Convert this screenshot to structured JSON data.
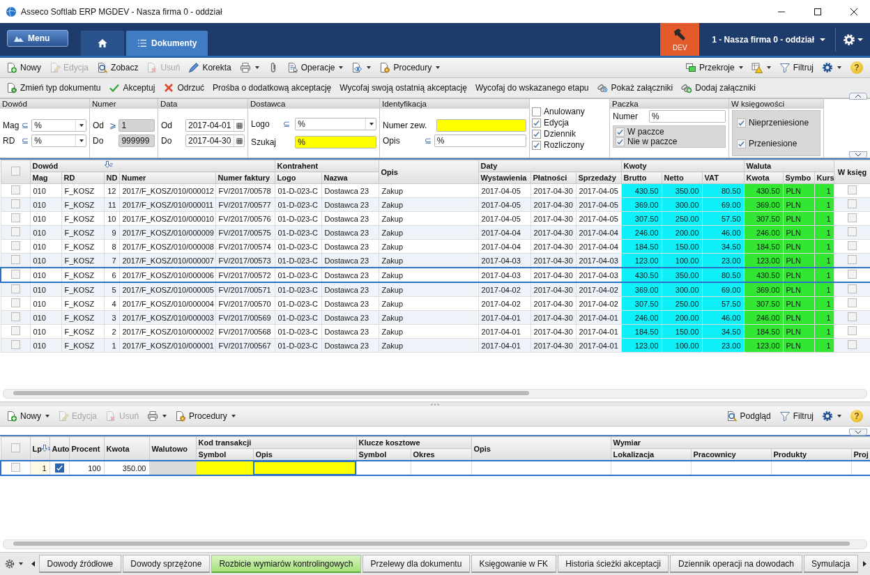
{
  "window": {
    "title": "Asseco Softlab ERP MGDEV - Nasza firma 0 - oddział"
  },
  "nav": {
    "menu": "Menu",
    "tabs": [
      {
        "kind": "home",
        "selected": false
      },
      {
        "kind": "documents",
        "label": "Dokumenty",
        "selected": true
      }
    ],
    "environment": "DEV",
    "company": "1 - Nasza firma 0 - oddział"
  },
  "toolbar": {
    "left": [
      {
        "kind": "new",
        "label": "Nowy",
        "disabled": false,
        "dropdown": false
      },
      {
        "kind": "edit",
        "label": "Edycja",
        "disabled": true,
        "dropdown": false
      },
      {
        "kind": "view",
        "label": "Zobacz",
        "disabled": false,
        "dropdown": false
      },
      {
        "kind": "delete",
        "label": "Usuń",
        "disabled": true,
        "dropdown": false
      },
      {
        "kind": "correct",
        "label": "Korekta",
        "disabled": false,
        "dropdown": false
      },
      {
        "kind": "print",
        "disabled": false,
        "dropdown": true
      },
      {
        "kind": "attach",
        "disabled": false,
        "dropdown": false
      },
      {
        "kind": "operations",
        "label": "Operacje",
        "disabled": false,
        "dropdown": true
      },
      {
        "kind": "preview",
        "disabled": false,
        "dropdown": true
      },
      {
        "kind": "procedures",
        "label": "Procedury",
        "disabled": false,
        "dropdown": true
      }
    ],
    "right": [
      {
        "kind": "sections",
        "label": "Przekroje",
        "disabled": false,
        "dropdown": true
      },
      {
        "kind": "warning",
        "disabled": false,
        "dropdown": true
      },
      {
        "kind": "filter",
        "label": "Filtruj",
        "disabled": false,
        "dropdown": false
      },
      {
        "kind": "settings",
        "disabled": false,
        "dropdown": true
      },
      {
        "kind": "help",
        "label": "?"
      }
    ]
  },
  "actions": [
    {
      "kind": "change-type",
      "label": "Zmień typ dokumentu",
      "disabled": false,
      "dropdown": false
    },
    {
      "kind": "accept",
      "label": "Akceptuj",
      "disabled": false,
      "dropdown": false
    },
    {
      "kind": "reject",
      "label": "Odrzuć",
      "disabled": false,
      "dropdown": false
    },
    {
      "kind": "text",
      "label": "Prośba o dodatkową akceptację",
      "disabled": false,
      "dropdown": false
    },
    {
      "kind": "text",
      "label": "Wycofaj swoją ostatnią akceptację",
      "disabled": false,
      "dropdown": false
    },
    {
      "kind": "text",
      "label": "Wycofaj do wskazanego etapu",
      "disabled": false,
      "dropdown": false
    },
    {
      "kind": "show-attachments",
      "label": "Pokaż załączniki",
      "disabled": false,
      "dropdown": false
    },
    {
      "kind": "add-attachments",
      "label": "Dodaj załączniki",
      "disabled": false,
      "dropdown": false
    }
  ],
  "filters": {
    "groups": [
      {
        "title": "Dowód",
        "fields": [
          {
            "kind": "combo",
            "label": "Mag",
            "operator": "⊆",
            "value": "%",
            "highlighted": false
          },
          {
            "kind": "combo",
            "label": "RD",
            "operator": "⊆",
            "value": "%",
            "highlighted": false
          }
        ]
      },
      {
        "title": "Numer",
        "fields": [
          {
            "kind": "readonly",
            "label": "Od",
            "operator": "⩾",
            "value": "1",
            "highlighted": false
          },
          {
            "kind": "readonly",
            "label": "Do",
            "value": "999999",
            "highlighted": false
          }
        ]
      },
      {
        "title": "Data",
        "fields": [
          {
            "kind": "date",
            "label": "Od",
            "value": "2017-04-01",
            "highlighted": false
          },
          {
            "kind": "date",
            "label": "Do",
            "value": "2017-04-30",
            "highlighted": false
          }
        ]
      },
      {
        "title": "Dostawca",
        "fields": [
          {
            "kind": "combo",
            "label": "Logo",
            "operator": "⊆",
            "value": "%",
            "highlighted": false
          },
          {
            "kind": "text",
            "label": "Szukaj",
            "value": "%",
            "highlighted": true
          }
        ]
      },
      {
        "title": "Identyfikacja",
        "fields": [
          {
            "kind": "text",
            "label": "Numer zew.",
            "highlighted": true
          },
          {
            "kind": "text",
            "label": "Opis",
            "operator": "⊆",
            "value": "%",
            "highlighted": false
          }
        ]
      }
    ],
    "states": [
      {
        "label": "Anulowany",
        "checked": false
      },
      {
        "label": "Edycja",
        "checked": true
      },
      {
        "label": "Dziennik",
        "checked": true
      },
      {
        "label": "Rozliczony",
        "checked": true
      }
    ],
    "paczka": {
      "title": "Paczka",
      "number_label": "Numer",
      "number_value": "%",
      "options": [
        {
          "label": "W paczce",
          "checked": true
        },
        {
          "label": "Nie w paczce",
          "checked": true
        }
      ]
    },
    "ksiegowosc": {
      "title": "W księgowości",
      "options": [
        {
          "label": "Nieprzeniesione",
          "checked": true
        },
        {
          "label": "Przeniesione",
          "checked": true
        }
      ]
    }
  },
  "documents": {
    "all_checked": false,
    "groups": [
      {
        "label": "Dowód",
        "columns": [
          {
            "label": "Mag",
            "kind": "text"
          },
          {
            "label": "RD",
            "kind": "text"
          },
          {
            "label": "ND",
            "kind": "num",
            "sort_order": "2"
          },
          {
            "label": "Numer",
            "kind": "text"
          },
          {
            "label": "Numer faktury",
            "kind": "text"
          }
        ]
      },
      {
        "label": "Kontrahent",
        "columns": [
          {
            "label": "Logo",
            "kind": "text"
          },
          {
            "label": "Nazwa",
            "kind": "text"
          }
        ]
      },
      {
        "label": "Opis",
        "columns": [
          {
            "kind": "text"
          }
        ]
      },
      {
        "label": "Daty",
        "columns": [
          {
            "label": "Wystawienia",
            "kind": "text"
          },
          {
            "label": "Płatności",
            "kind": "text"
          },
          {
            "label": "Sprzedaży",
            "kind": "text"
          }
        ]
      },
      {
        "label": "Kwoty",
        "columns": [
          {
            "label": "Brutto",
            "kind": "amount"
          },
          {
            "label": "Netto",
            "kind": "amount"
          },
          {
            "label": "VAT",
            "kind": "amount"
          }
        ]
      },
      {
        "label": "Waluta",
        "columns": [
          {
            "label": "Kwota",
            "kind": "currency-amount"
          },
          {
            "label": "Symbo",
            "kind": "currency"
          },
          {
            "label": "Kurs",
            "kind": "currency-amount"
          }
        ]
      },
      {
        "label": "W księg",
        "columns": [
          {
            "kind": "check"
          }
        ]
      }
    ],
    "rows": [
      {
        "checked": false,
        "selected": false,
        "posted": false,
        "cells": [
          "010",
          "F_KOSZ",
          "12",
          "2017/F_KOSZ/010/000012",
          "FV/2017/00578",
          "01-D-023-C",
          "Dostawca 23",
          "Zakup",
          "2017-04-05",
          "2017-04-30",
          "2017-04-05",
          "430.50",
          "350.00",
          "80.50",
          "430.50",
          "PLN",
          "1"
        ]
      },
      {
        "checked": false,
        "selected": false,
        "posted": false,
        "cells": [
          "010",
          "F_KOSZ",
          "11",
          "2017/F_KOSZ/010/000011",
          "FV/2017/00577",
          "01-D-023-C",
          "Dostawca 23",
          "Zakup",
          "2017-04-05",
          "2017-04-30",
          "2017-04-05",
          "369.00",
          "300.00",
          "69.00",
          "369.00",
          "PLN",
          "1"
        ]
      },
      {
        "checked": false,
        "selected": false,
        "posted": false,
        "cells": [
          "010",
          "F_KOSZ",
          "10",
          "2017/F_KOSZ/010/000010",
          "FV/2017/00576",
          "01-D-023-C",
          "Dostawca 23",
          "Zakup",
          "2017-04-05",
          "2017-04-30",
          "2017-04-05",
          "307.50",
          "250.00",
          "57.50",
          "307.50",
          "PLN",
          "1"
        ]
      },
      {
        "checked": false,
        "selected": false,
        "posted": false,
        "cells": [
          "010",
          "F_KOSZ",
          "9",
          "2017/F_KOSZ/010/000009",
          "FV/2017/00575",
          "01-D-023-C",
          "Dostawca 23",
          "Zakup",
          "2017-04-04",
          "2017-04-30",
          "2017-04-04",
          "246.00",
          "200.00",
          "46.00",
          "246.00",
          "PLN",
          "1"
        ]
      },
      {
        "checked": false,
        "selected": false,
        "posted": false,
        "cells": [
          "010",
          "F_KOSZ",
          "8",
          "2017/F_KOSZ/010/000008",
          "FV/2017/00574",
          "01-D-023-C",
          "Dostawca 23",
          "Zakup",
          "2017-04-04",
          "2017-04-30",
          "2017-04-04",
          "184.50",
          "150.00",
          "34.50",
          "184.50",
          "PLN",
          "1"
        ]
      },
      {
        "checked": false,
        "selected": false,
        "posted": false,
        "cells": [
          "010",
          "F_KOSZ",
          "7",
          "2017/F_KOSZ/010/000007",
          "FV/2017/00573",
          "01-D-023-C",
          "Dostawca 23",
          "Zakup",
          "2017-04-03",
          "2017-04-30",
          "2017-04-03",
          "123.00",
          "100.00",
          "23.00",
          "123.00",
          "PLN",
          "1"
        ]
      },
      {
        "checked": false,
        "selected": true,
        "posted": false,
        "cells": [
          "010",
          "F_KOSZ",
          "6",
          "2017/F_KOSZ/010/000006",
          "FV/2017/00572",
          "01-D-023-C",
          "Dostawca 23",
          "Zakup",
          "2017-04-03",
          "2017-04-30",
          "2017-04-03",
          "430.50",
          "350.00",
          "80.50",
          "430.50",
          "PLN",
          "1"
        ]
      },
      {
        "checked": false,
        "selected": false,
        "posted": false,
        "cells": [
          "010",
          "F_KOSZ",
          "5",
          "2017/F_KOSZ/010/000005",
          "FV/2017/00571",
          "01-D-023-C",
          "Dostawca 23",
          "Zakup",
          "2017-04-02",
          "2017-04-30",
          "2017-04-02",
          "369.00",
          "300.00",
          "69.00",
          "369.00",
          "PLN",
          "1"
        ]
      },
      {
        "checked": false,
        "selected": false,
        "posted": false,
        "cells": [
          "010",
          "F_KOSZ",
          "4",
          "2017/F_KOSZ/010/000004",
          "FV/2017/00570",
          "01-D-023-C",
          "Dostawca 23",
          "Zakup",
          "2017-04-02",
          "2017-04-30",
          "2017-04-02",
          "307.50",
          "250.00",
          "57.50",
          "307.50",
          "PLN",
          "1"
        ]
      },
      {
        "checked": false,
        "selected": false,
        "posted": false,
        "cells": [
          "010",
          "F_KOSZ",
          "3",
          "2017/F_KOSZ/010/000003",
          "FV/2017/00569",
          "01-D-023-C",
          "Dostawca 23",
          "Zakup",
          "2017-04-01",
          "2017-04-30",
          "2017-04-01",
          "246.00",
          "200.00",
          "46.00",
          "246.00",
          "PLN",
          "1"
        ]
      },
      {
        "checked": false,
        "selected": false,
        "posted": false,
        "cells": [
          "010",
          "F_KOSZ",
          "2",
          "2017/F_KOSZ/010/000002",
          "FV/2017/00568",
          "01-D-023-C",
          "Dostawca 23",
          "Zakup",
          "2017-04-01",
          "2017-04-30",
          "2017-04-01",
          "184.50",
          "150.00",
          "34.50",
          "184.50",
          "PLN",
          "1"
        ]
      },
      {
        "checked": false,
        "selected": false,
        "posted": false,
        "cells": [
          "010",
          "F_KOSZ",
          "1",
          "2017/F_KOSZ/010/000001",
          "FV/2017/00567",
          "01-D-023-C",
          "Dostawca 23",
          "Zakup",
          "2017-04-01",
          "2017-04-30",
          "2017-04-01",
          "123.00",
          "100.00",
          "23.00",
          "123.00",
          "PLN",
          "1"
        ]
      }
    ]
  },
  "lower_toolbar": {
    "left": [
      {
        "kind": "new",
        "label": "Nowy",
        "disabled": false,
        "dropdown": true
      },
      {
        "kind": "edit",
        "label": "Edycja",
        "disabled": true,
        "dropdown": false
      },
      {
        "kind": "delete",
        "label": "Usuń",
        "disabled": true,
        "dropdown": false
      },
      {
        "kind": "print",
        "disabled": false,
        "dropdown": true
      },
      {
        "kind": "procedures",
        "label": "Procedury",
        "disabled": false,
        "dropdown": true
      }
    ],
    "right": [
      {
        "kind": "view",
        "label": "Podgląd",
        "disabled": false,
        "dropdown": false
      },
      {
        "kind": "filter",
        "label": "Filtruj",
        "disabled": false,
        "dropdown": false
      },
      {
        "kind": "settings",
        "disabled": false,
        "dropdown": true
      },
      {
        "kind": "help",
        "label": "?"
      }
    ]
  },
  "split": {
    "all_checked": false,
    "groups": [
      {
        "columns": [
          {
            "label": "Lp",
            "kind": "lp",
            "sort_order": "1"
          }
        ]
      },
      {
        "columns": [
          {
            "label": "Auto",
            "kind": "check"
          }
        ]
      },
      {
        "columns": [
          {
            "label": "Procent",
            "kind": "num"
          }
        ]
      },
      {
        "columns": [
          {
            "label": "Kwota",
            "kind": "num"
          }
        ]
      },
      {
        "columns": [
          {
            "label": "Walutowo",
            "kind": "readonly"
          }
        ]
      },
      {
        "label": "Kod transakcji",
        "columns": [
          {
            "label": "Symbol",
            "kind": "required"
          },
          {
            "label": "Opis",
            "kind": "required"
          }
        ]
      },
      {
        "label": "Klucze kosztowe",
        "columns": [
          {
            "label": "Symbol",
            "kind": "text"
          },
          {
            "label": "Okres",
            "kind": "text"
          }
        ]
      },
      {
        "label": "Opis",
        "columns": [
          {
            "kind": "text"
          }
        ]
      },
      {
        "label": "Wymiar",
        "columns": [
          {
            "label": "Lokalizacja",
            "kind": "text"
          },
          {
            "label": "Pracownicy",
            "kind": "text"
          },
          {
            "label": "Produkty",
            "kind": "text"
          },
          {
            "label": "Proj",
            "kind": "text"
          }
        ]
      }
    ],
    "rows": [
      {
        "checked": false,
        "selected": true,
        "cells": [
          {
            "value": "1"
          },
          {
            "checked": true
          },
          {
            "value": "100"
          },
          {
            "value": "350.00"
          },
          {},
          {},
          {
            "focused": true
          },
          {},
          {},
          {},
          {},
          {},
          {},
          {}
        ]
      }
    ]
  },
  "bottom_tabs": [
    {
      "label": "Dowody źródłowe",
      "selected": false
    },
    {
      "label": "Dowody sprzężone",
      "selected": false
    },
    {
      "label": "Rozbicie wymiarów kontrolingowych",
      "selected": true
    },
    {
      "label": "Przelewy dla dokumentu",
      "selected": false
    },
    {
      "label": "Księgowanie w FK",
      "selected": false
    },
    {
      "label": "Historia ścieżki akceptacji",
      "selected": false
    },
    {
      "label": "Dziennik operacji na dowodach",
      "selected": false
    },
    {
      "label": "Symulacja",
      "selected": false
    }
  ]
}
